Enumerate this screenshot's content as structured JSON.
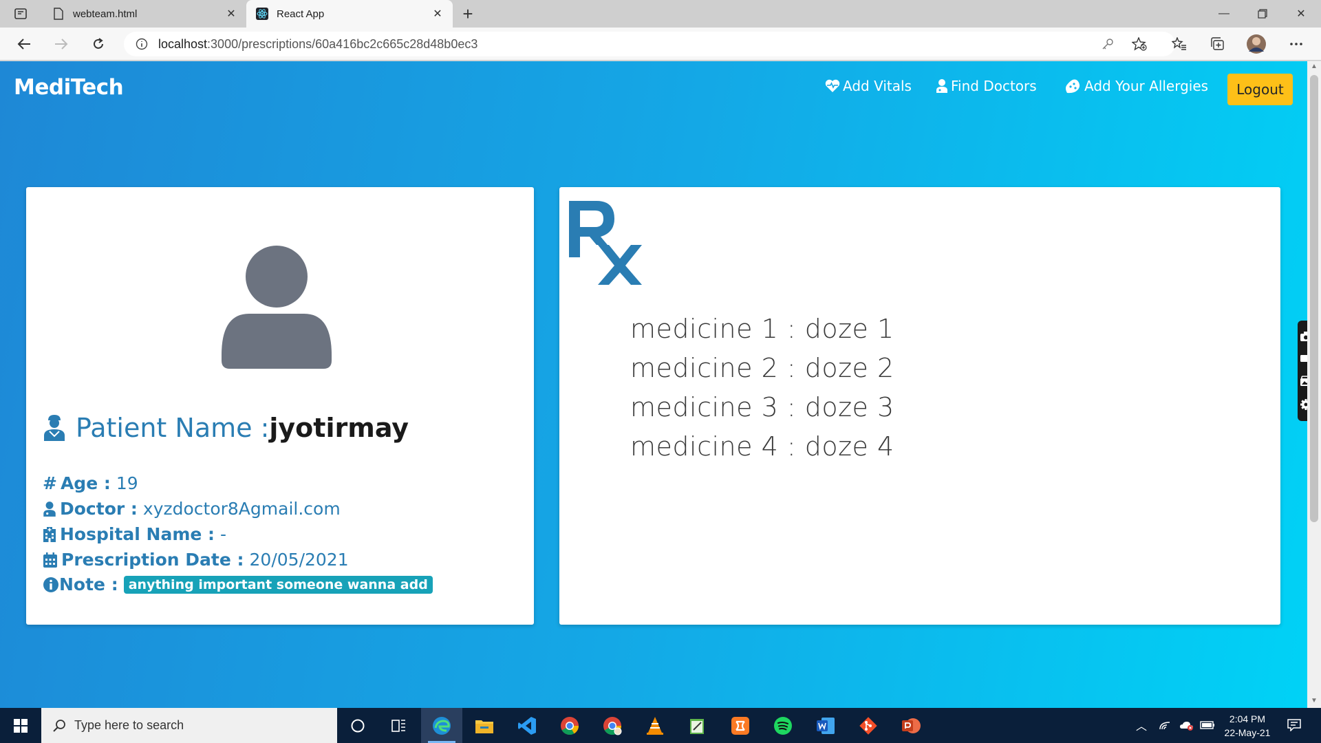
{
  "browser": {
    "tabs": [
      {
        "title": "webteam.html",
        "active": false,
        "icon": "file-icon"
      },
      {
        "title": "React App",
        "active": true,
        "icon": "react-icon"
      }
    ],
    "url_host": "localhost",
    "url_path": ":3000/prescriptions/60a416bc2c665c28d48b0ec3"
  },
  "app": {
    "brand": "MediTech",
    "nav": [
      {
        "label": "Add Vitals",
        "icon": "heart-pulse-icon"
      },
      {
        "label": "Find Doctors",
        "icon": "doctor-icon"
      },
      {
        "label": "Add Your Allergies",
        "icon": "allergies-icon"
      }
    ],
    "logout_label": "Logout",
    "colors": {
      "accent": "#2a7db3",
      "logout": "#fdc018",
      "badge": "#17a2b8",
      "gradient_start": "#1e88d6",
      "gradient_end": "#00d2f6"
    }
  },
  "patient": {
    "name_label": "Patient Name :",
    "name": "jyotirmay",
    "age_label": "Age :",
    "age": "19",
    "doctor_label": "Doctor :",
    "doctor": "xyzdoctor8Agmail.com",
    "hospital_label": "Hospital Name :",
    "hospital": "-",
    "date_label": "Prescription Date :",
    "date": "20/05/2021",
    "note_label": "Note :",
    "note": "anything important someone wanna add"
  },
  "prescription": {
    "medicines": [
      "medicine 1 : doze 1",
      "medicine 2 : doze 2",
      "medicine 3 : doze 3",
      "medicine 4 : doze 4"
    ]
  },
  "taskbar": {
    "search_placeholder": "Type here to search",
    "time": "2:04 PM",
    "date": "22-May-21"
  }
}
